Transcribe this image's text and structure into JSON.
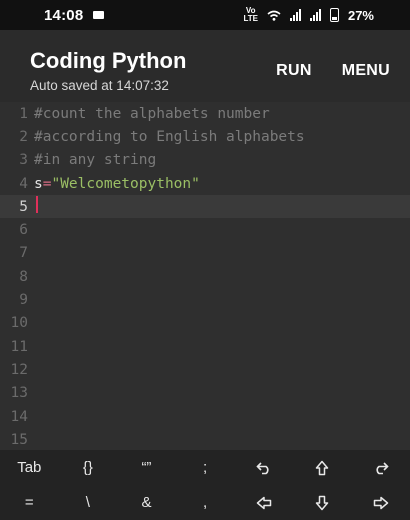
{
  "status_bar": {
    "time": "14:08",
    "network": "VoLTE",
    "battery": "27%"
  },
  "app_bar": {
    "title": "Coding Python",
    "subtitle": "Auto saved at 14:07:32",
    "run_label": "RUN",
    "menu_label": "MENU"
  },
  "editor": {
    "active_line": 5,
    "lines": [
      {
        "num": "1",
        "comment": "#count the alphabets number"
      },
      {
        "num": "2",
        "comment": "#according to English alphabets"
      },
      {
        "num": "3",
        "comment": "#in any string"
      },
      {
        "num": "4",
        "ident": "s",
        "op": "=",
        "string": "\"Welcometopython\""
      },
      {
        "num": "5"
      },
      {
        "num": "6"
      },
      {
        "num": "7"
      },
      {
        "num": "8"
      },
      {
        "num": "9"
      },
      {
        "num": "10"
      },
      {
        "num": "11"
      },
      {
        "num": "12"
      },
      {
        "num": "13"
      },
      {
        "num": "14"
      },
      {
        "num": "15"
      }
    ]
  },
  "keyboard": {
    "row1": [
      "Tab",
      "{}",
      "“”",
      ";",
      "undo-icon",
      "shift-up-icon",
      "redo-icon"
    ],
    "row2": [
      "=",
      "\\",
      "&",
      ",",
      "arrow-left-icon",
      "arrow-down-icon",
      "arrow-right-icon"
    ],
    "tab": "Tab",
    "braces": "{}",
    "quotes": "“”",
    "semicolon": ";",
    "equals": "=",
    "backslash": "\\",
    "ampersand": "&",
    "comma": ","
  }
}
